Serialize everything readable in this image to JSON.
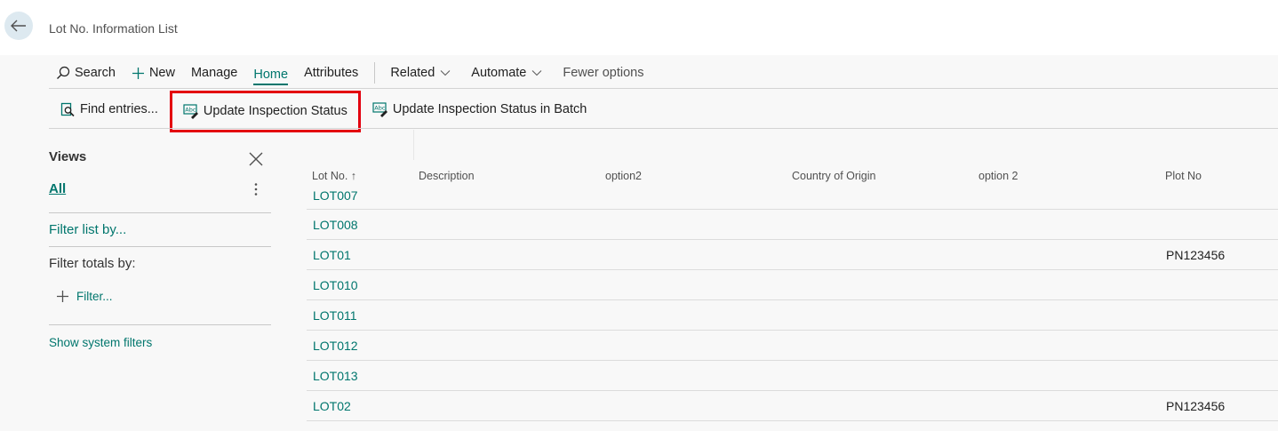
{
  "header": {
    "title": "Lot No. Information List"
  },
  "actionbar": {
    "search": "Search",
    "new": "New",
    "manage": "Manage",
    "home": "Home",
    "attributes": "Attributes",
    "related": "Related",
    "automate": "Automate",
    "fewer_options": "Fewer options"
  },
  "promoted": {
    "find_entries": "Find entries...",
    "update_status": "Update Inspection Status",
    "update_status_batch": "Update Inspection Status in Batch"
  },
  "views": {
    "title": "Views",
    "all": "All",
    "filter_list": "Filter list by...",
    "filter_totals": "Filter totals by:",
    "filter_add": "Filter...",
    "show_system_filters": "Show system filters"
  },
  "grid": {
    "columns": [
      "Lot No. ↑",
      "Description",
      "option2",
      "Country of Origin",
      "option 2",
      "Plot No"
    ],
    "rows": [
      {
        "lot": "LOT007",
        "plot": ""
      },
      {
        "lot": "LOT008",
        "plot": ""
      },
      {
        "lot": "LOT01",
        "plot": "PN123456"
      },
      {
        "lot": "LOT010",
        "plot": ""
      },
      {
        "lot": "LOT011",
        "plot": ""
      },
      {
        "lot": "LOT012",
        "plot": ""
      },
      {
        "lot": "LOT013",
        "plot": ""
      },
      {
        "lot": "LOT02",
        "plot": "PN123456"
      }
    ]
  },
  "colors": {
    "accent": "#00766d",
    "highlight": "#e3000f"
  }
}
